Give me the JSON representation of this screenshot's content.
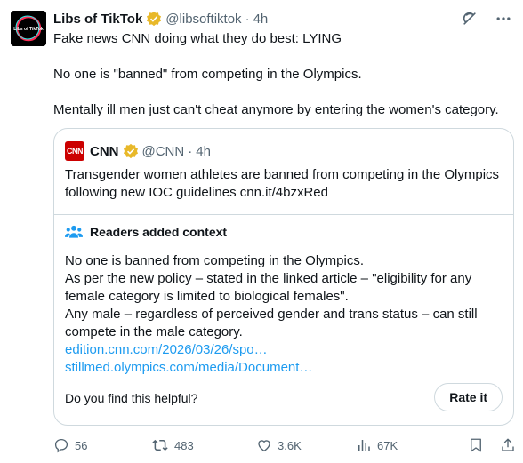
{
  "author": {
    "name": "Libs of TikTok",
    "handle": "@libsoftiktok",
    "separator": "·",
    "time": "4h",
    "avatar_icon": "libs-of-tiktok-logo",
    "avatar_text": "Libs of TikTok"
  },
  "tweet": {
    "line1": "Fake news CNN doing what they do best: LYING",
    "line2": "No one is \"banned\" from competing in the Olympics.",
    "line3": "Mentally ill men just can't cheat anymore by entering the women's category."
  },
  "quote": {
    "name": "CNN",
    "logo_text": "CNN",
    "handle": "@CNN",
    "separator": "·",
    "time": "4h",
    "text": "Transgender women athletes are banned from competing in the Olympics following new IOC guidelines cnn.it/4bzxRed"
  },
  "context": {
    "title": "Readers added context",
    "line1": "No one is banned from competing in the Olympics.",
    "line2": "As per the new policy – stated in the linked article – \"eligibility for any female category is limited to biological females\".",
    "line3": "Any male – regardless of perceived gender and trans status – can still compete in the male category.",
    "link1": "edition.cnn.com/2026/03/26/spo…",
    "link2": "stillmed.olympics.com/media/Document…",
    "helpful_question": "Do you find this helpful?",
    "rate_label": "Rate it"
  },
  "actions": {
    "replies": "56",
    "reposts": "483",
    "likes": "3.6K",
    "views": "67K"
  },
  "colors": {
    "link": "#1d9bf0",
    "secondary_text": "#536471",
    "border": "#cfd9de",
    "verified": "#e8b829",
    "cnn_red": "#cc0000"
  }
}
